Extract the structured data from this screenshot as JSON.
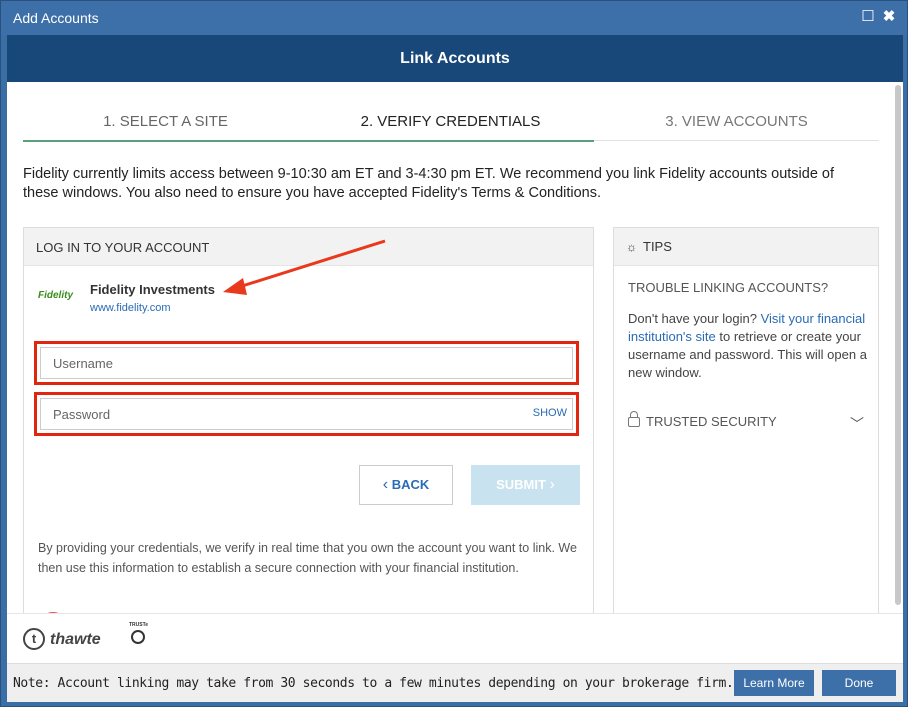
{
  "window": {
    "title": "Add Accounts",
    "maximize_glyph": "☐",
    "close_glyph": "✖"
  },
  "header": {
    "title": "Link Accounts"
  },
  "steps": [
    {
      "label": "1. SELECT A SITE"
    },
    {
      "label": "2. VERIFY CREDENTIALS"
    },
    {
      "label": "3. VIEW ACCOUNTS"
    }
  ],
  "notice": "Fidelity currently limits access between 9-10:30 am ET and 3-4:30 pm ET. We recommend you link Fidelity accounts outside of these windows. You also need to ensure you have accepted Fidelity's Terms & Conditions.",
  "login": {
    "heading": "LOG IN TO YOUR ACCOUNT",
    "institution_logo": "Fidelity",
    "institution_name": "Fidelity Investments",
    "institution_url": "www.fidelity.com",
    "username_placeholder": "Username",
    "password_placeholder": "Password",
    "show_label": "SHOW",
    "back_label": "BACK",
    "submit_label": "SUBMIT",
    "disclaimer": "By providing your credentials, we verify in real time that you own the account you want to link. We then use this information to establish a secure connection with your financial institution."
  },
  "tips": {
    "heading": "TIPS",
    "trouble": "TROUBLE LINKING ACCOUNTS?",
    "text_before": "Don't have your login? ",
    "link_text": "Visit your financial institution's site",
    "text_after": " to retrieve or create your username and password. This will open a new window.",
    "trusted": "TRUSTED SECURITY"
  },
  "logos": {
    "thawte_mark": "t",
    "thawte": "thawte",
    "truste": "TRUSTe"
  },
  "footer": {
    "note": "Note: Account linking may take from 30 seconds to a few minutes depending on your brokerage firm.",
    "learn_more": "Learn More",
    "done": "Done"
  },
  "colors": {
    "accent": "#3d70a8",
    "header": "#18487a",
    "highlight": "#e0260f",
    "link": "#2a6bb5"
  }
}
